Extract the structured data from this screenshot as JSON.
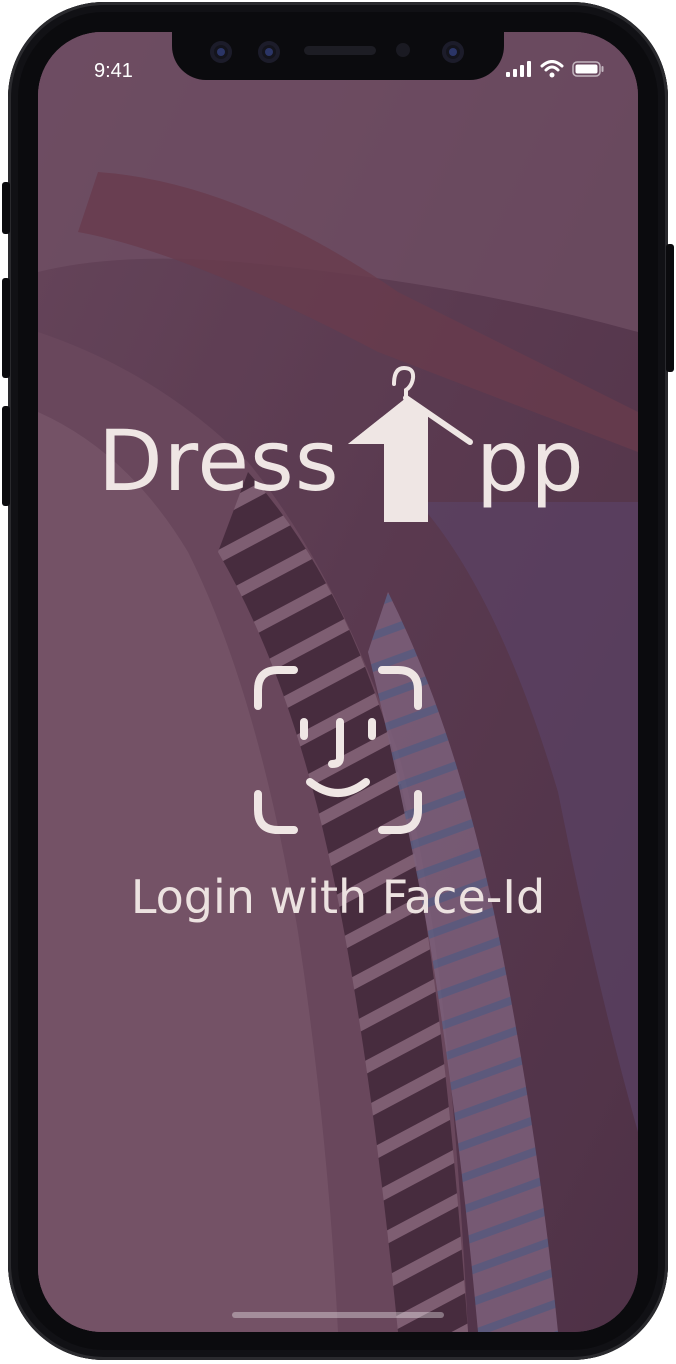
{
  "status_bar": {
    "time": "9:41"
  },
  "logo": {
    "text_left": "Dress",
    "text_right": "pp",
    "icon": "hanger-arrow-icon"
  },
  "face_id": {
    "icon": "face-id-icon",
    "label": "Login with Face-Id"
  },
  "colors": {
    "overlay": "#5a3a4f",
    "text": "#efe6e4"
  }
}
